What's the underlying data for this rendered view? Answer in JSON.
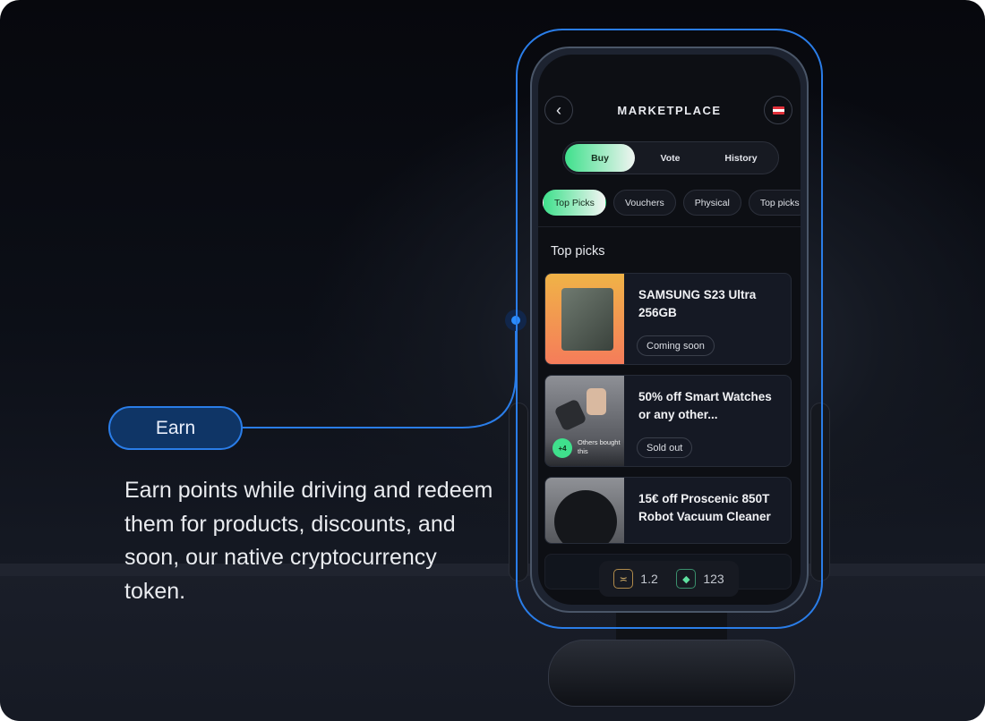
{
  "feature": {
    "label": "Earn",
    "description": "Earn points while driving and redeem them for products, discounts, and soon, our native cryptocurrency token."
  },
  "colors": {
    "accent": "#2a7de8",
    "green": "#3fe08c",
    "background": "#0c0f17"
  },
  "app": {
    "title": "MARKETPLACE",
    "back_icon": "chevron-left-icon",
    "flag_icon": "flag-icon",
    "tabs": [
      {
        "label": "Buy",
        "active": true
      },
      {
        "label": "Vote"
      },
      {
        "label": "History"
      }
    ],
    "chips": [
      {
        "label": "Top Picks",
        "active": true
      },
      {
        "label": "Vouchers"
      },
      {
        "label": "Physical"
      },
      {
        "label": "Top picks"
      }
    ],
    "section_title": "Top picks",
    "products": [
      {
        "title": "SAMSUNG S23 Ultra 256GB",
        "status": "Coming soon"
      },
      {
        "title": "50% off Smart Watches or any other...",
        "status": "Sold out",
        "social": {
          "count": "+4",
          "text": "Others bought this"
        }
      },
      {
        "title": "15€ off Proscenic 850T Robot Vacuum Cleaner"
      }
    ],
    "stats": [
      {
        "icon": "multiplier-icon",
        "value": "1.2"
      },
      {
        "icon": "token-icon",
        "value": "123"
      }
    ]
  }
}
